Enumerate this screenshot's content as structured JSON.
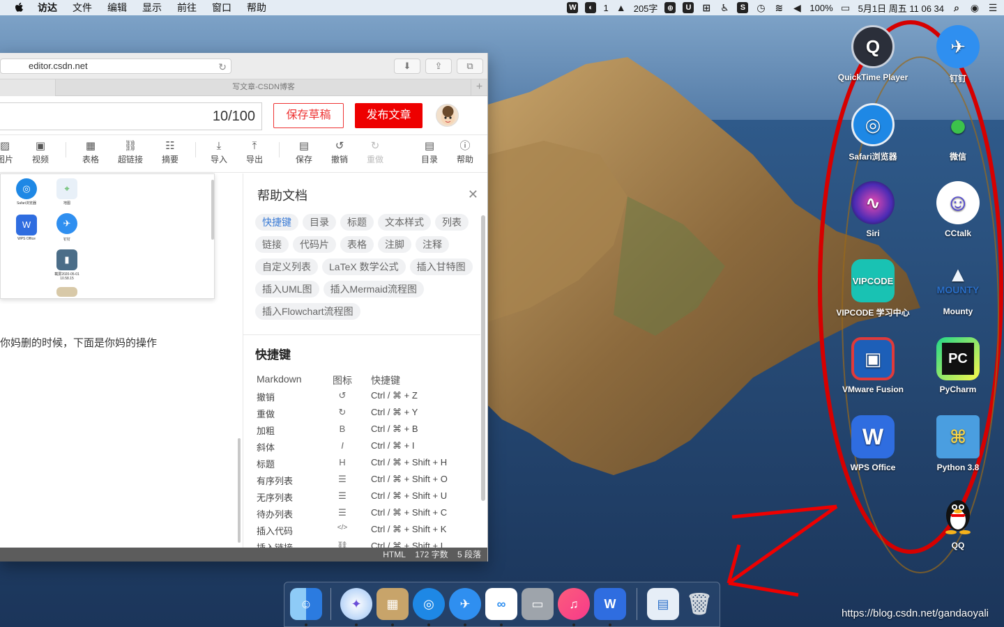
{
  "menubar": {
    "items": [
      "访达",
      "文件",
      "编辑",
      "显示",
      "前往",
      "窗口",
      "帮助"
    ],
    "tray": {
      "word_count": "205字",
      "badge_num": "1",
      "battery": "100%",
      "datetime": "5月1日 周五 11 06 34"
    }
  },
  "browser": {
    "url": "editor.csdn.net",
    "tab_title": "写文章-CSDN博客",
    "title_counter": "10/100",
    "save_draft": "保存草稿",
    "publish": "发布文章",
    "tools": [
      "图片",
      "视频",
      "表格",
      "超链接",
      "摘要",
      "导入",
      "导出",
      "保存",
      "撤销",
      "重做",
      "目录",
      "帮助"
    ],
    "editor_text": "你妈删的时候，下面是你妈的操作",
    "preview_labels": [
      "Safari浏览器",
      "地图",
      "WPS Office",
      "钉钉",
      "截屏2020-05-01 10.58.15"
    ],
    "status": {
      "mode": "HTML",
      "words": "172 字数",
      "paragraphs": "5 段落"
    }
  },
  "help": {
    "title": "帮助文档",
    "chips": [
      "快捷键",
      "目录",
      "标题",
      "文本样式",
      "列表",
      "链接",
      "代码片",
      "表格",
      "注脚",
      "注释",
      "自定义列表",
      "LaTeX 数学公式",
      "插入甘特图",
      "插入UML图",
      "插入Mermaid流程图",
      "插入Flowchart流程图"
    ],
    "section_title": "快捷键",
    "columns": [
      "Markdown",
      "图标",
      "快捷键"
    ],
    "rows": [
      {
        "name": "撤销",
        "icon": "↺",
        "key": "Ctrl / ⌘ + Z"
      },
      {
        "name": "重做",
        "icon": "↻",
        "key": "Ctrl / ⌘ + Y"
      },
      {
        "name": "加粗",
        "icon": "B",
        "key": "Ctrl / ⌘ + B"
      },
      {
        "name": "斜体",
        "icon": "I",
        "key": "Ctrl / ⌘ + I"
      },
      {
        "name": "标题",
        "icon": "H",
        "key": "Ctrl / ⌘ + Shift + H"
      },
      {
        "name": "有序列表",
        "icon": "☰",
        "key": "Ctrl / ⌘ + Shift + O"
      },
      {
        "name": "无序列表",
        "icon": "☰",
        "key": "Ctrl / ⌘ + Shift + U"
      },
      {
        "name": "待办列表",
        "icon": "☰",
        "key": "Ctrl / ⌘ + Shift + C"
      },
      {
        "name": "插入代码",
        "icon": "</>",
        "key": "Ctrl / ⌘ + Shift + K"
      },
      {
        "name": "插入链接",
        "icon": "⛓",
        "key": "Ctrl / ⌘ + Shift + L"
      }
    ]
  },
  "desktop": {
    "icons": [
      {
        "label": "QuickTime Player",
        "color": "#2b2f3a"
      },
      {
        "label": "钉钉",
        "color": "#2f8ff0"
      },
      {
        "label": "Safari浏览器",
        "color": "#1e88e5"
      },
      {
        "label": "微信",
        "color": "#3cc24b"
      },
      {
        "label": "Siri",
        "color": "#6a3bd1"
      },
      {
        "label": "CCtalk",
        "color": "#4b3fd8"
      },
      {
        "label": "VIPCODE 学习中心",
        "color": "#19c2b3"
      },
      {
        "label": "Mounty",
        "color": "#f4f8fd"
      },
      {
        "label": "VMware Fusion",
        "color": "#1d5fb8"
      },
      {
        "label": "PyCharm",
        "color": "#1d1d1d"
      },
      {
        "label": "WPS Office",
        "color": "#2f6de0"
      },
      {
        "label": "Python 3.8",
        "color": "#4a9ee0"
      },
      {
        "label": "QQ",
        "color": "#111111"
      }
    ]
  },
  "dock": [
    "Finder",
    "Launchpad",
    "Archive Utility",
    "Safari",
    "钉钉",
    "百度网盘",
    "磁盘工具",
    "Music",
    "WPS Office",
    "Preview",
    "Trash"
  ],
  "watermark": "https://blog.csdn.net/gandaoyali"
}
